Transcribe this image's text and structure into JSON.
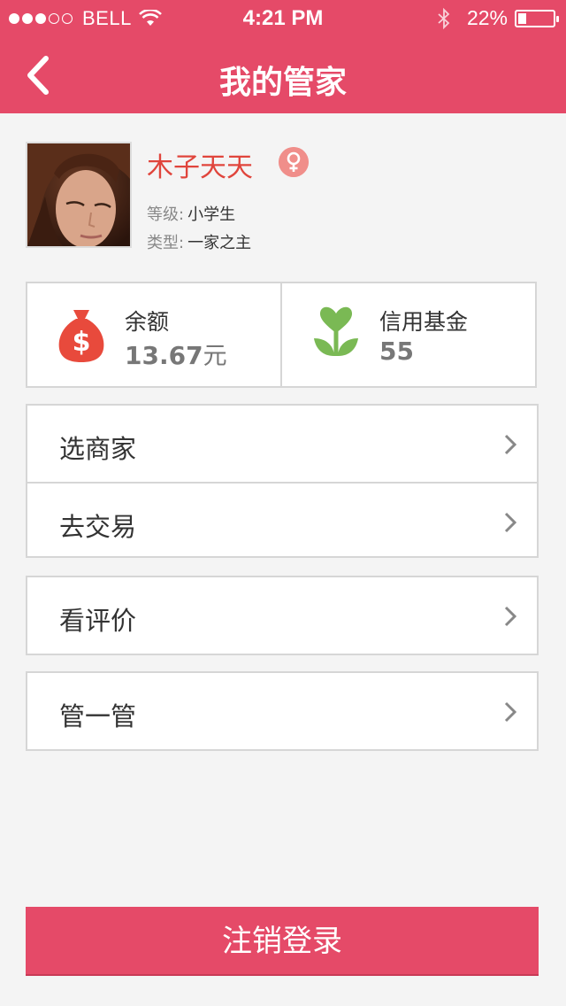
{
  "status_bar": {
    "carrier": "BELL",
    "time": "4:21 PM",
    "battery": "22%",
    "signal_bars_filled": 3,
    "signal_bars_total": 5,
    "battery_level": 0.22
  },
  "header": {
    "title": "我的管家",
    "back_icon": "chevron-left-icon"
  },
  "profile": {
    "name": "木子天天",
    "gender_icon": "female-icon",
    "level_label": "等级:",
    "level_value": "小学生",
    "type_label": "类型:",
    "type_value": "一家之主"
  },
  "stats": [
    {
      "label": "余额",
      "value": "13.67",
      "unit": "元",
      "icon": "money-bag-icon"
    },
    {
      "label": "信用基金",
      "value": "55",
      "unit": "",
      "icon": "sprout-heart-icon"
    }
  ],
  "menu_groups": [
    [
      "选商家",
      "去交易"
    ],
    [
      "看评价"
    ],
    [
      "管一管"
    ]
  ],
  "logout_label": "注销登录",
  "colors": {
    "brand": "#e54a68",
    "name": "#e0453c",
    "money_icon": "#e84a3c",
    "credit_icon": "#7ab954",
    "gender_badge": "#f08e8a"
  }
}
